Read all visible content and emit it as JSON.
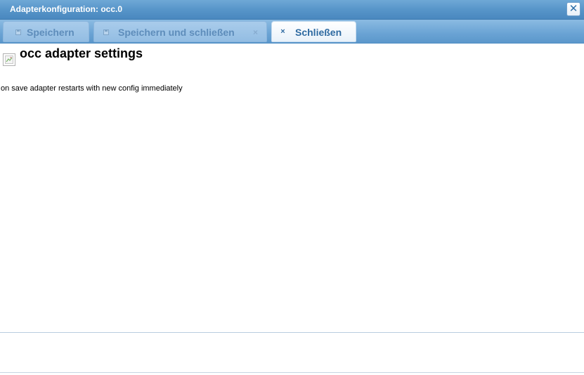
{
  "window": {
    "title": "Adapterkonfiguration: occ.0"
  },
  "toolbar": {
    "save_label": "Speichern",
    "save_close_label": "Speichern und schließen",
    "close_label": "Schließen"
  },
  "content": {
    "heading": "occ adapter settings",
    "note": "on save adapter restarts with new config immediately"
  },
  "icons": {
    "close": "close-icon",
    "save": "disk-icon",
    "logo": "broken-image-icon"
  },
  "colors": {
    "titlebar": "#5795c9",
    "buttonbar": "#6aa3d4",
    "active_button_text": "#2e6aa1"
  }
}
